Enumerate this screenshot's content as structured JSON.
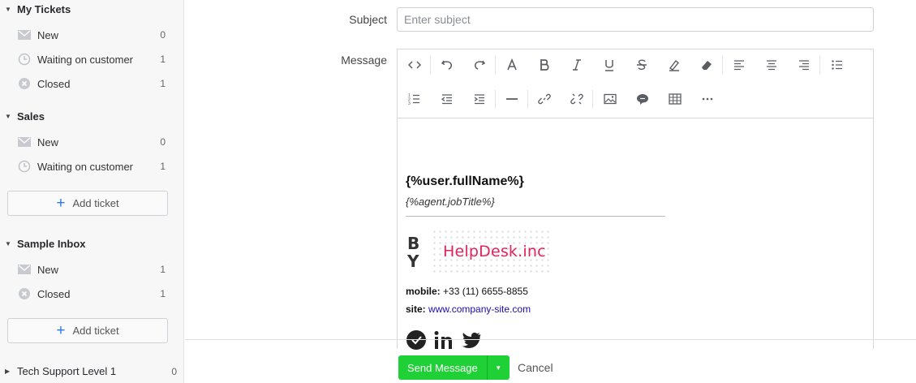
{
  "sidebar": {
    "groups": [
      {
        "title": "My Tickets",
        "items": [
          {
            "label": "New",
            "count": "0",
            "icon": "envelope-icon"
          },
          {
            "label": "Waiting on customer",
            "count": "1",
            "icon": "clock-icon"
          },
          {
            "label": "Closed",
            "count": "1",
            "icon": "closed-icon"
          }
        ]
      },
      {
        "title": "Sales",
        "items": [
          {
            "label": "New",
            "count": "0",
            "icon": "envelope-icon"
          },
          {
            "label": "Waiting on customer",
            "count": "1",
            "icon": "clock-icon"
          }
        ],
        "add_label": "Add ticket"
      },
      {
        "title": "Sample Inbox",
        "items": [
          {
            "label": "New",
            "count": "1",
            "icon": "envelope-icon"
          },
          {
            "label": "Closed",
            "count": "1",
            "icon": "closed-icon"
          }
        ],
        "add_label": "Add ticket"
      },
      {
        "title": "Tech Support Level 1",
        "count": "0"
      }
    ]
  },
  "form": {
    "subject_label": "Subject",
    "subject_placeholder": "Enter subject",
    "subject_value": "",
    "message_label": "Message"
  },
  "toolbar": {
    "row1": [
      "code-view-icon",
      "undo-icon",
      "redo-icon",
      "font-color-icon",
      "bold-icon",
      "italic-icon",
      "underline-icon",
      "strikethrough-icon",
      "highlight-icon",
      "eraser-icon",
      "align-left-icon",
      "align-center-icon",
      "align-right-icon",
      "bullet-list-icon"
    ],
    "row2": [
      "numbered-list-icon",
      "outdent-icon",
      "indent-icon",
      "horizontal-rule-icon",
      "link-icon",
      "unlink-icon",
      "image-icon",
      "comment-icon",
      "table-icon",
      "more-icon"
    ]
  },
  "signature": {
    "name": "{%user.fullName%}",
    "job_title": "{%agent.jobTitle%}",
    "logo_by": "B Y",
    "logo_text": "HelpDesk.inc",
    "mobile_label": "mobile:",
    "mobile_value": "+33 (11) 6655-8855",
    "site_label": "site:",
    "site_value": "www.company-site.com",
    "social": [
      "chat-icon",
      "linkedin-icon",
      "twitter-icon"
    ]
  },
  "actions": {
    "send_label": "Send Message",
    "cancel_label": "Cancel"
  },
  "colors": {
    "send_button": "#1fd136",
    "accent_blue": "#2d7be0",
    "logo_pink": "#e0245e",
    "link": "#1a0dab"
  }
}
